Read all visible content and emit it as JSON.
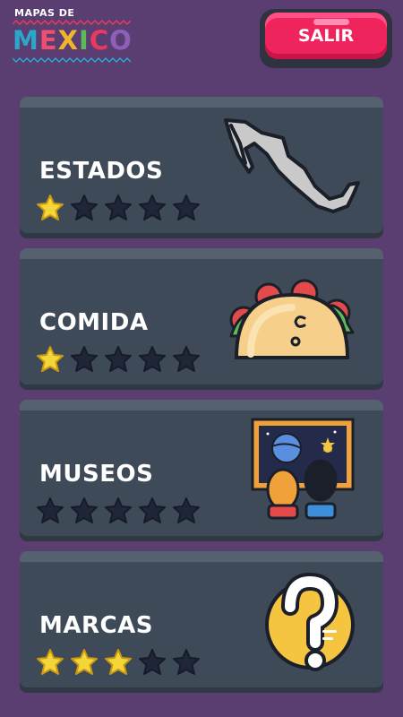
{
  "header": {
    "logo_subtitle": "MAPAS DE",
    "logo_letters": [
      "M",
      "E",
      "X",
      "I",
      "C",
      "O"
    ],
    "exit_label": "SALIR"
  },
  "categories": [
    {
      "title": "ESTADOS",
      "stars_earned": 1,
      "stars_total": 5,
      "icon": "mexico-map-icon"
    },
    {
      "title": "COMIDA",
      "stars_earned": 1,
      "stars_total": 5,
      "icon": "taco-icon"
    },
    {
      "title": "MUSEOS",
      "stars_earned": 0,
      "stars_total": 5,
      "icon": "museum-visitors-icon"
    },
    {
      "title": "MARCAS",
      "stars_earned": 3,
      "stars_total": 5,
      "icon": "question-mark-icon"
    }
  ],
  "colors": {
    "background": "#5a3e72",
    "card": "#3f4a58",
    "exit_button": "#f0245d",
    "star_filled": "#f5d63a",
    "star_empty": "#1f2638"
  }
}
